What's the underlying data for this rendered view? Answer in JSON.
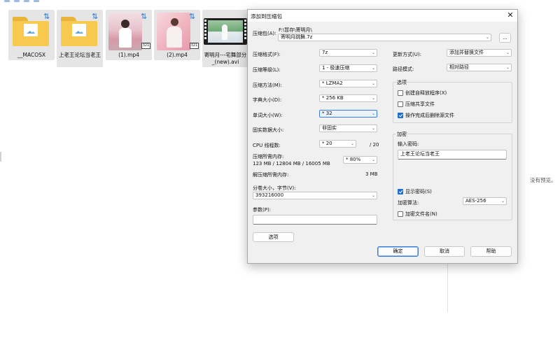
{
  "explorer": {
    "items": [
      {
        "name": "__MACOSX",
        "kind": "folder"
      },
      {
        "name": "上老王论坛当老王",
        "kind": "folder"
      },
      {
        "name": "(1).mp4",
        "kind": "video",
        "badge": "321"
      },
      {
        "name": "(2).mp4",
        "kind": "video",
        "badge": "321"
      },
      {
        "name": "寄明月---宅舞部分_(new).avi",
        "kind": "avi"
      }
    ],
    "preview_text": "没有预览。"
  },
  "dialog": {
    "title": "添加到压缩包",
    "close_glyph": "✕",
    "archive_label": "压缩包(A):",
    "archive_path": "F:\\暂存\\寄明月\\",
    "archive_name": "寄明月跳舞.7z",
    "browse_label": "...",
    "left": {
      "format_label": "压缩格式(F):",
      "format_value": "7z",
      "level_label": "压缩等级(L):",
      "level_value": "1 - 极速压缩",
      "method_label": "压缩方法(M):",
      "method_value": "* LZMA2",
      "dict_label": "字典大小(D):",
      "dict_value": "* 256 KB",
      "word_label": "单词大小(W):",
      "word_value": "* 32",
      "solid_label": "固实数据大小:",
      "solid_value": "非固实",
      "cpu_label": "CPU 线程数:",
      "cpu_value": "* 20",
      "cpu_total": "/ 20",
      "mem_label": "压缩所需内存:",
      "mem_values": "123 MB / 12804 MB / 16005 MB",
      "mem_percent": "* 80%",
      "decomp_label": "解压缩所需内存:",
      "decomp_value": "3 MB",
      "split_label": "分卷大小，字节(V):",
      "split_value": "393216000",
      "params_label": "参数(P):",
      "params_value": "",
      "options_button": "选项"
    },
    "right": {
      "update_label": "更新方式(U):",
      "update_value": "添加并替换文件",
      "path_label": "路径模式:",
      "path_value": "相对路径",
      "options_title": "选项",
      "opt_sfx": {
        "label": "创建自释放程序(X)",
        "checked": false
      },
      "opt_shared": {
        "label": "压缩共享文件",
        "checked": false
      },
      "opt_delete": {
        "label": "操作完成后删除源文件",
        "checked": true
      },
      "encrypt_title": "加密",
      "password_label": "输入密码:",
      "password_value": "上老王论坛当老王",
      "show_pw": {
        "label": "显示密码(S)",
        "checked": true
      },
      "enc_method_label": "加密算法:",
      "enc_method_value": "AES-256",
      "enc_names": {
        "label": "加密文件名(N)",
        "checked": false
      }
    },
    "buttons": {
      "ok": "确定",
      "cancel": "取消",
      "help": "帮助"
    }
  },
  "colors": {
    "accent": "#1c6fd1",
    "focus_border": "#3b7ddc",
    "folder": "#f7c94e",
    "dialog_bg": "#f0f0f0"
  },
  "icons": [
    "folder-icon",
    "sync-icon",
    "video-thumb",
    "close-icon",
    "chevron-down-icon",
    "checkbox-icon"
  ]
}
